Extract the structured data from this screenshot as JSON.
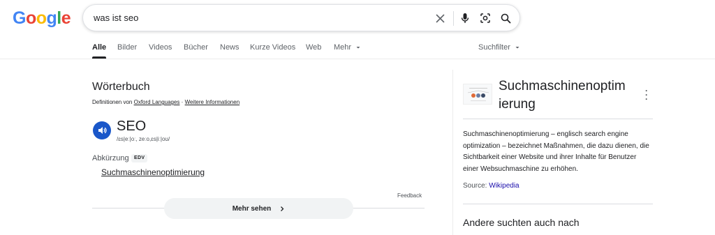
{
  "logo": {
    "letters": [
      "G",
      "o",
      "o",
      "g",
      "l",
      "e"
    ],
    "colors": [
      "#4285F4",
      "#EA4335",
      "#FBBC05",
      "#4285F4",
      "#34A853",
      "#EA4335"
    ]
  },
  "search": {
    "query": "was ist seo"
  },
  "icons": {
    "clear": "close-icon",
    "mic": "microphone-icon",
    "lens": "lens-icon",
    "search": "search-icon"
  },
  "tabs": [
    {
      "label": "Alle",
      "active": true
    },
    {
      "label": "Bilder"
    },
    {
      "label": "Videos"
    },
    {
      "label": "Bücher"
    },
    {
      "label": "News"
    },
    {
      "label": "Kurze Videos"
    },
    {
      "label": "Web"
    },
    {
      "label": "Mehr"
    }
  ],
  "tools_label": "Suchfilter",
  "dictionary": {
    "title": "Wörterbuch",
    "source_prefix": "Definitionen von",
    "source_link": "Oxford Languages",
    "source_sep": "·",
    "more_info": "Weitere Informationen",
    "word": "SEO",
    "phonetic": "/ɛs|eː|oː, zeːo,ɛs|iː|oʊ/",
    "abbr_label": "Abkürzung",
    "badge": "EDV",
    "definition": "Suchmaschinenoptimierung",
    "feedback": "Feedback",
    "more_button": "Mehr sehen"
  },
  "knowledge_panel": {
    "title": "Suchmaschinenoptimierung",
    "title_line1": "Suchmaschinenoptim",
    "title_line2": "ierung",
    "description": "Suchmaschinenoptimierung – englisch search engine optimization – bezeichnet Maßnahmen, die dazu dienen, die Sichtbarkeit einer Website und ihrer Inhalte für Benutzer einer Websuchmaschine zu erhöhen.",
    "source_label": "Source:",
    "source_link": "Wikipedia",
    "others_heading": "Andere suchten auch nach"
  },
  "colors": {
    "accent_blue": "#1a57c9",
    "link": "#1a0dab"
  }
}
